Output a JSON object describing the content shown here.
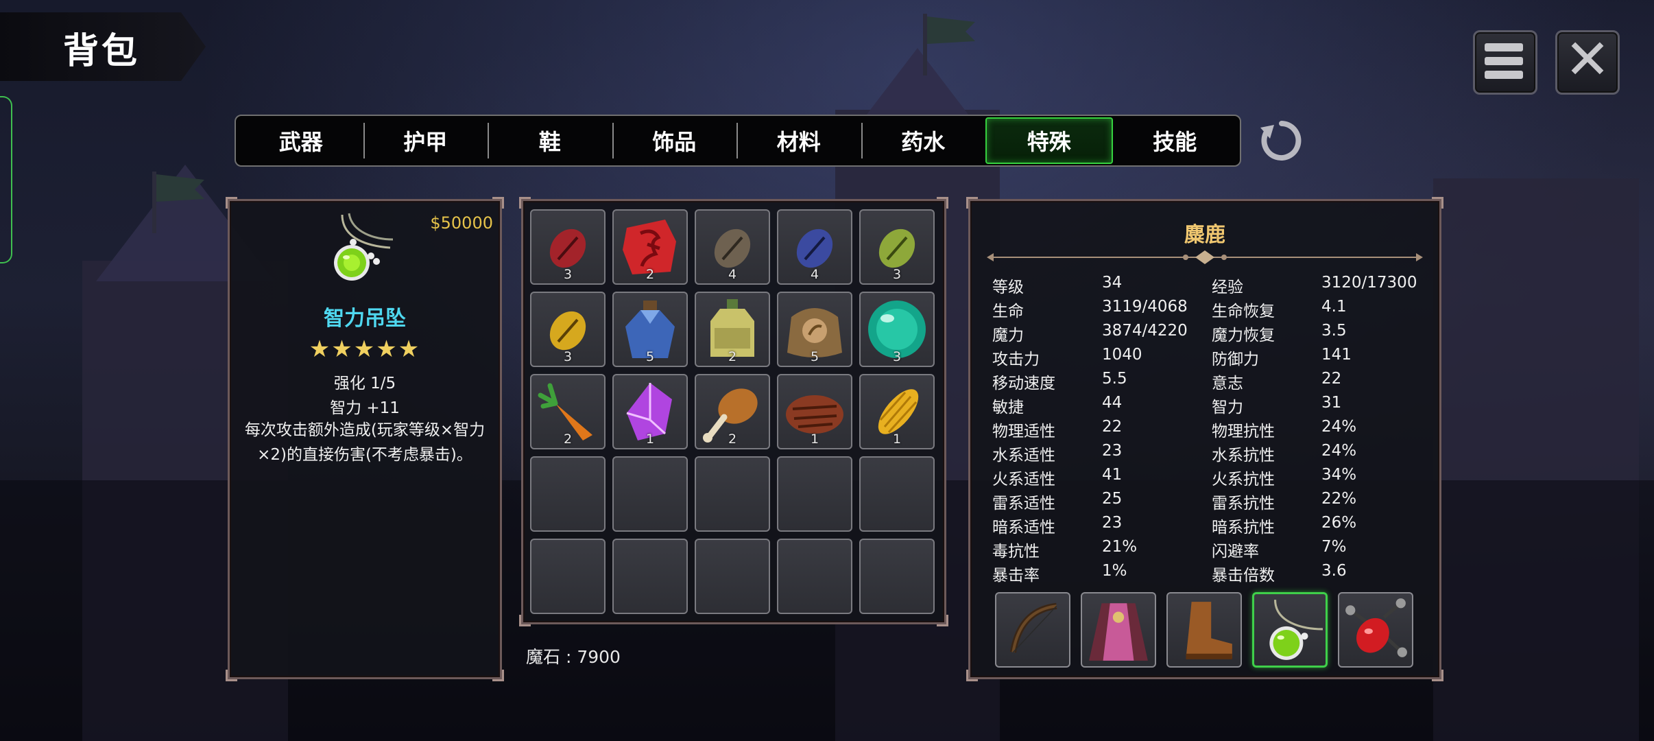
{
  "title": "背包",
  "tabs": [
    {
      "label": "武器",
      "active": false
    },
    {
      "label": "护甲",
      "active": false
    },
    {
      "label": "鞋",
      "active": false
    },
    {
      "label": "饰品",
      "active": false
    },
    {
      "label": "材料",
      "active": false
    },
    {
      "label": "药水",
      "active": false
    },
    {
      "label": "特殊",
      "active": true
    },
    {
      "label": "技能",
      "active": false
    }
  ],
  "top_buttons": {
    "menu_icon": "menu-icon",
    "close_icon": "close-icon",
    "refresh_icon": "refresh-icon"
  },
  "selected_item": {
    "price": "$50000",
    "name": "智力吊坠",
    "stars": "★★★★★",
    "enhance": "强化 1/5",
    "stat": "智力 +11",
    "description": "每次攻击额外造成(玩家等级×智力×2)的直接伤害(不考虑暴击)。",
    "icon": "pendant-icon"
  },
  "inventory": [
    {
      "icon": "red-seed-icon",
      "count": "3"
    },
    {
      "icon": "red-rune-stone-icon",
      "count": "2"
    },
    {
      "icon": "brown-seed-icon",
      "count": "4"
    },
    {
      "icon": "blue-seed-icon",
      "count": "4"
    },
    {
      "icon": "green-seed-icon",
      "count": "3"
    },
    {
      "icon": "yellow-seed-icon",
      "count": "3"
    },
    {
      "icon": "blue-potion-icon",
      "count": "5"
    },
    {
      "icon": "yellow-potion-icon",
      "count": "2"
    },
    {
      "icon": "seed-bag-icon",
      "count": "5"
    },
    {
      "icon": "teal-orb-icon",
      "count": "3"
    },
    {
      "icon": "carrot-icon",
      "count": "2"
    },
    {
      "icon": "purple-crystal-icon",
      "count": "1"
    },
    {
      "icon": "chicken-leg-icon",
      "count": "2"
    },
    {
      "icon": "steak-icon",
      "count": "1"
    },
    {
      "icon": "corn-icon",
      "count": "1"
    },
    {
      "icon": "empty-slot",
      "count": ""
    },
    {
      "icon": "empty-slot",
      "count": ""
    },
    {
      "icon": "empty-slot",
      "count": ""
    },
    {
      "icon": "empty-slot",
      "count": ""
    },
    {
      "icon": "empty-slot",
      "count": ""
    },
    {
      "icon": "empty-slot",
      "count": ""
    },
    {
      "icon": "empty-slot",
      "count": ""
    },
    {
      "icon": "empty-slot",
      "count": ""
    },
    {
      "icon": "empty-slot",
      "count": ""
    },
    {
      "icon": "empty-slot",
      "count": ""
    }
  ],
  "currency": "魔石 : 7900",
  "character": {
    "name": "麋鹿",
    "stats": [
      [
        "等级",
        "34",
        "经验",
        "3120/17300"
      ],
      [
        "生命",
        "3119/4068",
        "生命恢复",
        "4.1"
      ],
      [
        "魔力",
        "3874/4220",
        "魔力恢复",
        "3.5"
      ],
      [
        "攻击力",
        "1040",
        "防御力",
        "141"
      ],
      [
        "移动速度",
        "5.5",
        "意志",
        "22"
      ],
      [
        "敏捷",
        "44",
        "智力",
        "31"
      ],
      [
        "物理适性",
        "22",
        "物理抗性",
        "24%"
      ],
      [
        "水系适性",
        "23",
        "水系抗性",
        "24%"
      ],
      [
        "火系适性",
        "41",
        "火系抗性",
        "34%"
      ],
      [
        "雷系适性",
        "25",
        "雷系抗性",
        "22%"
      ],
      [
        "暗系适性",
        "23",
        "暗系抗性",
        "26%"
      ],
      [
        "毒抗性",
        "21%",
        "闪避率",
        "7%"
      ],
      [
        "暴击率",
        "1%",
        "暴击倍数",
        "3.6"
      ]
    ],
    "equipment": [
      {
        "icon": "bow-icon",
        "selected": false
      },
      {
        "icon": "robe-icon",
        "selected": false
      },
      {
        "icon": "boots-icon",
        "selected": false
      },
      {
        "icon": "pendant-icon",
        "selected": true
      },
      {
        "icon": "ruby-ring-icon",
        "selected": false
      }
    ]
  },
  "colors": {
    "accent_green": "#36d23f",
    "item_name": "#4fd8f0",
    "price": "#e6c34a",
    "char_name": "#f0c770"
  }
}
